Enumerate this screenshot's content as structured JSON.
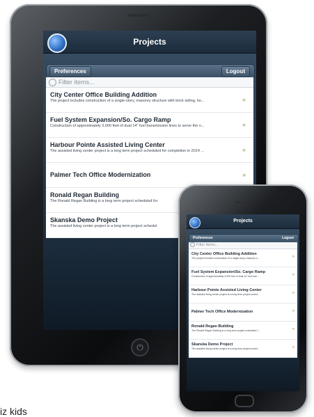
{
  "app": {
    "title": "Projects",
    "preferences_label": "Preferences",
    "logout_label": "Logout",
    "filter_placeholder": "Filter items...",
    "arrow_glyph": "»",
    "accent_color": "#2e6dc2"
  },
  "projects": [
    {
      "name": "City Center Office Building Addition",
      "desc": "The project includes construction of a single-story, masonry structure with brick siding, ho...",
      "desc_phone": "The project includes construction of a single-story, masonry s..."
    },
    {
      "name": "Fuel System Expansion/So. Cargo Ramp",
      "desc": "Construction of approximately 3,000 feet of dual 14\" fuel transmission lines to serve the n...",
      "desc_phone": "Construction of approximately 3,000 feet of dual 14\" fuel tran..."
    },
    {
      "name": "Harbour Pointe Assisted Living Center",
      "desc": "The assisted living center project is a long term project scheduled for completion in 2014 ...",
      "desc_phone": "The assisted living center project is a long term project sched..."
    },
    {
      "name": "Palmer Tech Office Modernization",
      "desc": "",
      "desc_phone": ""
    },
    {
      "name": "Ronald Regan Building",
      "desc": "The Ronald Regan Building is a long term project scheduled for",
      "desc_phone": "The Ronald Regan Building is a long term project scheduled f..."
    },
    {
      "name": "Skanska Demo Project",
      "desc": "The assisted living center project is a long term project schedul",
      "desc_phone": "The assisted living center project is a long term project sched..."
    }
  ],
  "caption": "iz kids"
}
